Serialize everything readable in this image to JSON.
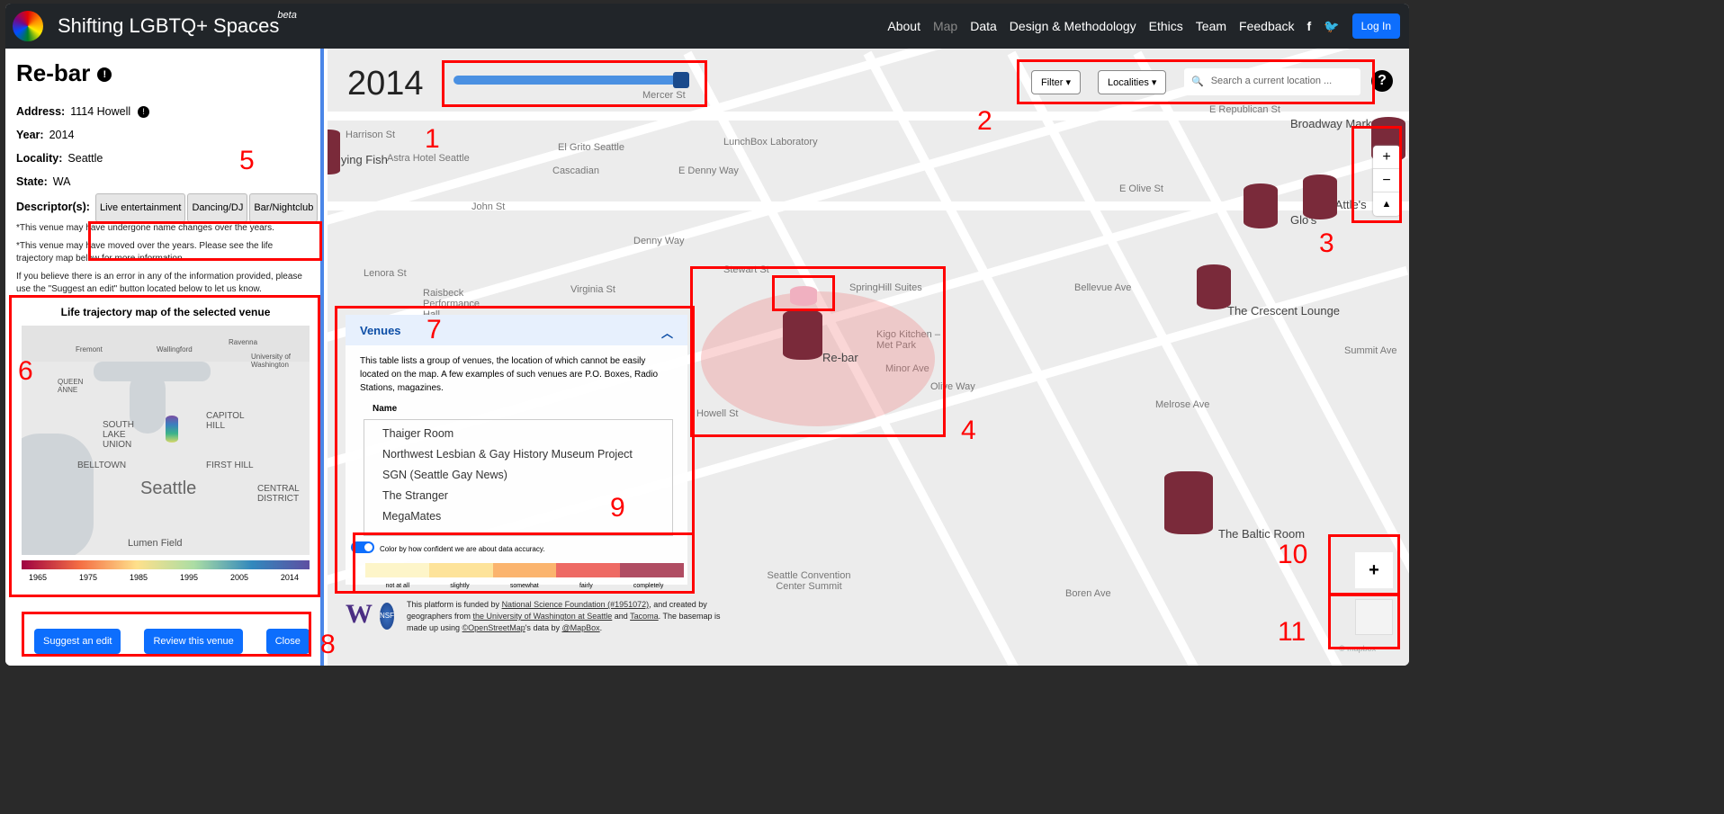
{
  "header": {
    "title": "Shifting LGBTQ+ Spaces",
    "beta": "beta",
    "nav": [
      "About",
      "Map",
      "Data",
      "Design & Methodology",
      "Ethics",
      "Team",
      "Feedback"
    ],
    "active_nav": "Map",
    "login": "Log In"
  },
  "venue": {
    "name": "Re-bar",
    "address_label": "Address:",
    "address": "1114 Howell",
    "year_label": "Year:",
    "year": "2014",
    "locality_label": "Locality:",
    "locality": "Seattle",
    "state_label": "State:",
    "state": "WA",
    "descriptors_label": "Descriptor(s):",
    "descriptors": [
      "Live entertainment",
      "Dancing/DJ",
      "Bar/Nightclub"
    ],
    "notes": [
      "*This venue may have undergone name changes over the years.",
      "*This venue may have moved over the years. Please see the life trajectory map below for more information.",
      "If you believe there is an error in any of the information provided, please use the \"Suggest an edit\" button located below to let us know."
    ]
  },
  "trajectory": {
    "title": "Life trajectory map of the selected venue",
    "labels": [
      "QUEEN ANNE",
      "SOUTH LAKE UNION",
      "CAPITOL HILL",
      "BELLTOWN",
      "FIRST HILL",
      "Seattle",
      "CENTRAL DISTRICT",
      "Lumen Field",
      "Fremont",
      "Wallingford",
      "Ravenna",
      "University of Washington"
    ],
    "ticks": [
      "1965",
      "1975",
      "1985",
      "1995",
      "2005",
      "2014"
    ]
  },
  "actions": {
    "suggest": "Suggest an edit",
    "review": "Review this venue",
    "close": "Close"
  },
  "map": {
    "year": "2014",
    "slider_fraction": 1.0,
    "filter": "Filter",
    "localities": "Localities",
    "search_placeholder": "Search a current location ...",
    "labels": [
      "Mercer St",
      "Harrison St",
      "Flying Fish",
      "Astra Hotel Seattle",
      "John St",
      "Denny Way",
      "Lenora St",
      "Virginia St",
      "Stewart St",
      "Howell St",
      "Olive Way",
      "Boren Ave",
      "Minor Ave",
      "Bellevue Ave",
      "Melrose Ave",
      "E Republican St",
      "Broadway Market",
      "Glo's",
      "CC Attle's",
      "The Crescent Lounge",
      "The Baltic Room",
      "Seattle Convention Center Summit",
      "Raisbeck Performance Hall",
      "SpringHill Suites",
      "Kigo Kitchen – Met Park",
      "Re-bar",
      "Summit Ave",
      "E Olive St",
      "E Denny Way",
      "LunchBox Laboratory",
      "Cascadian",
      "El Grito Seattle"
    ],
    "mapbox": "© mapbox"
  },
  "venues_panel": {
    "title": "Venues",
    "description": "This table lists a group of venues, the location of which cannot be easily located on the map. A few examples of such venues are P.O. Boxes, Radio Stations, magazines.",
    "column": "Name",
    "items": [
      "Thaiger Room",
      "Northwest Lesbian & Gay History Museum Project",
      "SGN (Seattle Gay News)",
      "The Stranger",
      "MegaMates"
    ]
  },
  "legend": {
    "toggle_label": "Color by how confident we are about data accuracy.",
    "toggle_on": true,
    "levels": [
      "not at all",
      "slightly",
      "somewhat",
      "fairly",
      "completely"
    ],
    "colors": [
      "#fdf5c9",
      "#fde39a",
      "#fbb46e",
      "#ee6a64",
      "#b04d63"
    ]
  },
  "credits": {
    "uw": "W",
    "nsf": "NSF",
    "text1": "This platform is funded by ",
    "nsf_link": "National Science Foundation (#1951072)",
    "text2": ", and created by geographers from ",
    "uw_link": "the University of Washington at Seattle",
    "text3": " and ",
    "tacoma": "Tacoma",
    "text4": ". The basemap is made up using ",
    "osm": "©OpenStreetMap",
    "text5": "'s data by ",
    "mapbox": "@MapBox",
    "text6": "."
  },
  "annotations": [
    "1",
    "2",
    "3",
    "4",
    "5",
    "6",
    "7",
    "8",
    "9",
    "10",
    "11"
  ]
}
